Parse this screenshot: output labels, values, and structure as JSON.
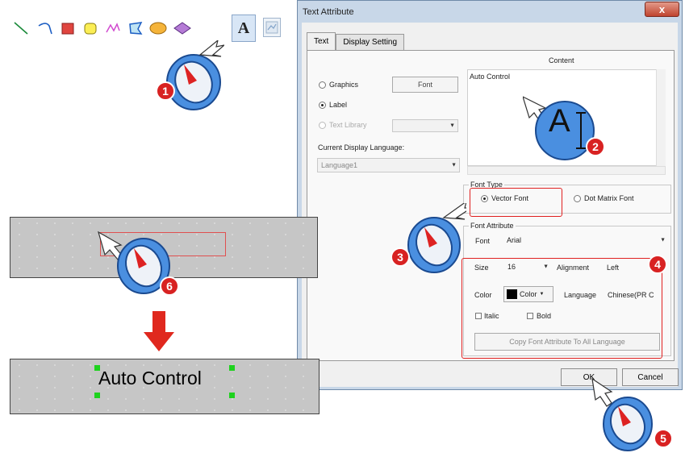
{
  "toolbar": {
    "text_tool_glyph": "A",
    "tools": [
      "line-icon",
      "arc-icon",
      "rectangle-icon",
      "rounded-rectangle-icon",
      "polyline-icon",
      "polygon-icon",
      "ellipse-icon",
      "diamond-icon",
      "text-icon",
      "picture-icon"
    ]
  },
  "dialog": {
    "title": "Text Attribute",
    "close_glyph": "x",
    "tabs": [
      {
        "label": "Text"
      },
      {
        "label": "Display Setting"
      }
    ],
    "content_label": "Content",
    "content_value": "Auto Control",
    "source_options": [
      {
        "label": "Graphics",
        "selected": false
      },
      {
        "label": "Label",
        "selected": true
      },
      {
        "label": "Text Library",
        "selected": false
      }
    ],
    "font_button": "Font",
    "current_language_label": "Current Display Language:",
    "current_language_value": "Language1",
    "font_type_label": "Font Type",
    "font_type_options": [
      {
        "label": "Vector Font",
        "selected": true
      },
      {
        "label": "Dot Matrix Font",
        "selected": false
      }
    ],
    "font_attribute_label": "Font Attribute",
    "font_label": "Font",
    "font_value": "Arial",
    "size_label": "Size",
    "size_value": "16",
    "alignment_label": "Alignment",
    "alignment_value": "Left",
    "color_label": "Color",
    "color_button": "Color",
    "color_value": "#000000",
    "language_label": "Language",
    "language_value": "Chinese(PR C",
    "italic_label": "Italic",
    "bold_label": "Bold",
    "copy_button": "Copy Font Attribute To All Language",
    "ok_button": "OK",
    "cancel_button": "Cancel"
  },
  "canvas": {
    "result_text": "Auto Control",
    "arrow_color": "#e0281e"
  },
  "steps": [
    "1",
    "2",
    "3",
    "4",
    "5",
    "6"
  ],
  "text_cursor_glyph": "A",
  "colors": {
    "accent_blue": "#4a8fe0",
    "badge_red": "#d82222",
    "highlight_red": "#e02020",
    "handle_green": "#1ed21e"
  }
}
